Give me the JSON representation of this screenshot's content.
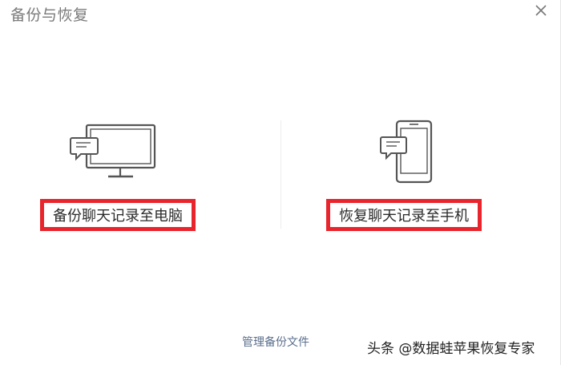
{
  "window": {
    "title": "备份与恢复",
    "close_icon": "close-icon"
  },
  "options": {
    "backup": {
      "label": "备份聊天记录至电脑",
      "icon": "monitor-chat-icon"
    },
    "restore": {
      "label": "恢复聊天记录至手机",
      "icon": "phone-chat-icon"
    }
  },
  "footer": {
    "manage_label": "管理备份文件"
  },
  "watermark": {
    "text": "头条 @数据蛙苹果恢复专家"
  },
  "colors": {
    "highlight_border": "#e8252c",
    "icon_stroke": "#555555",
    "link": "#5a6f8c",
    "title": "#7a7a7a"
  }
}
